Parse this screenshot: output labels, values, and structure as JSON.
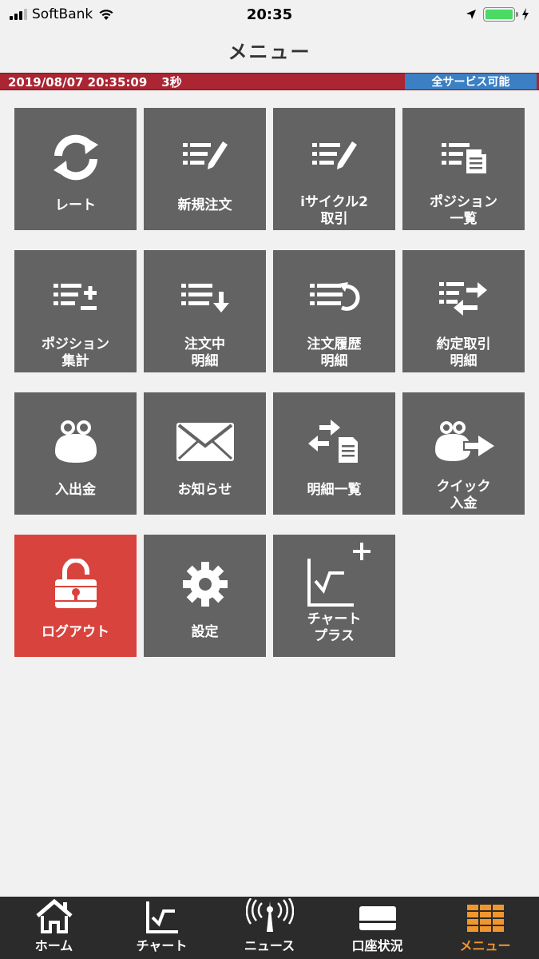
{
  "status_bar": {
    "carrier": "SoftBank",
    "time": "20:35",
    "wifi_icon": "wifi-icon",
    "location_icon": "location-arrow-icon",
    "battery_icon": "battery-icon",
    "charging_icon": "charging-bolt-icon"
  },
  "nav": {
    "title": "メニュー"
  },
  "info": {
    "datetime": "2019/08/07 20:35:09",
    "interval": "3秒",
    "service_status": "全サービス可能",
    "bar_color": "#ab2533",
    "badge_color": "#3b7fc4"
  },
  "menu": {
    "tiles": [
      {
        "label": "レート",
        "icon": "refresh-icon"
      },
      {
        "label": "新規注文",
        "icon": "new-order-icon"
      },
      {
        "label": "iサイクル2\n取引",
        "icon": "icycle-order-icon"
      },
      {
        "label": "ポジション\n一覧",
        "icon": "position-list-icon"
      },
      {
        "label": "ポジション\n集計",
        "icon": "position-summary-icon"
      },
      {
        "label": "注文中\n明細",
        "icon": "pending-order-icon"
      },
      {
        "label": "注文履歴\n明細",
        "icon": "order-history-icon"
      },
      {
        "label": "約定取引\n明細",
        "icon": "executed-trade-icon"
      },
      {
        "label": "入出金",
        "icon": "purse-icon"
      },
      {
        "label": "お知らせ",
        "icon": "envelope-icon"
      },
      {
        "label": "明細一覧",
        "icon": "statement-list-icon"
      },
      {
        "label": "クイック\n入金",
        "icon": "quick-deposit-icon"
      },
      {
        "label": "ログアウト",
        "icon": "unlock-icon"
      },
      {
        "label": "設定",
        "icon": "gear-icon"
      },
      {
        "label": "チャート\nプラス",
        "icon": "chart-plus-icon"
      }
    ],
    "tile_color": "#636363",
    "logout_color": "#d9433d"
  },
  "tabbar": {
    "items": [
      {
        "label": "ホーム",
        "icon": "home-icon"
      },
      {
        "label": "チャート",
        "icon": "chart-icon"
      },
      {
        "label": "ニュース",
        "icon": "news-antenna-icon"
      },
      {
        "label": "口座状況",
        "icon": "account-card-icon"
      },
      {
        "label": "メニュー",
        "icon": "menu-grid-icon",
        "active": true
      }
    ],
    "active_color": "#f0962e"
  }
}
